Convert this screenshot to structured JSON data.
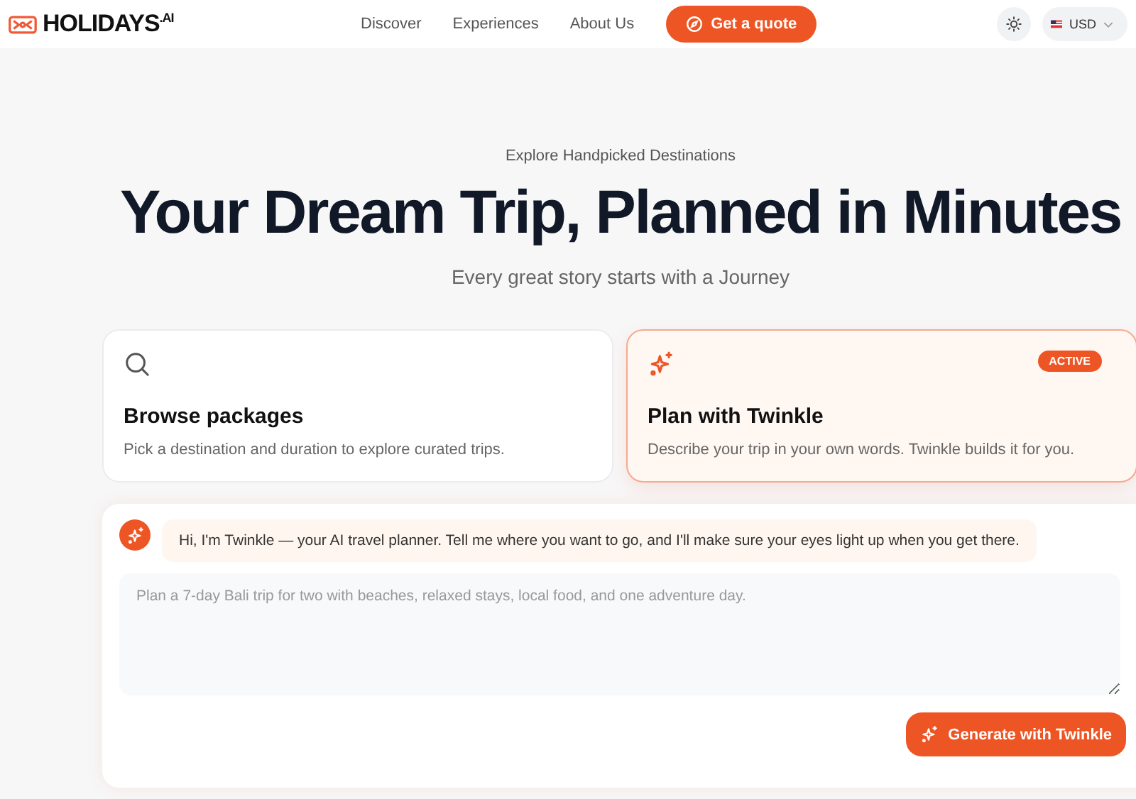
{
  "header": {
    "logo": "HOLIDAYS$^{.AI}$",
    "nav": [
      {
        "label": "Discover"
      },
      {
        "label": "Experiences"
      },
      {
        "label": "About Us"
      }
    ],
    "cta": "Get a quote",
    "currency": "USD"
  },
  "hero": {
    "eyebrow": "Explore Handpicked Destinations",
    "title": "Your Dream Trip, Planned in Minutes",
    "subtitle": "Every great story starts with a Journey"
  },
  "modes": [
    {
      "kind": "search",
      "title": "Browse packages",
      "description": "Pick a destination and duration to explore curated trips.",
      "selected": false
    },
    {
      "kind": "sparkle",
      "title": "Plan with Twinkle",
      "description": "Describe your trip in your own words. Twinkle builds it for you.",
      "selected": true,
      "badge": "ACTIVE"
    }
  ],
  "chat": {
    "message": "Hi, I'm Twinkle — your AI travel planner. Tell me where you want to go, and I'll make sure your eyes light up when you get there.",
    "placeholder": "Plan a 7-day Bali trip for two with beaches, relaxed stays, local food, and one adventure day.",
    "submit": "Generate with Twinkle"
  }
}
